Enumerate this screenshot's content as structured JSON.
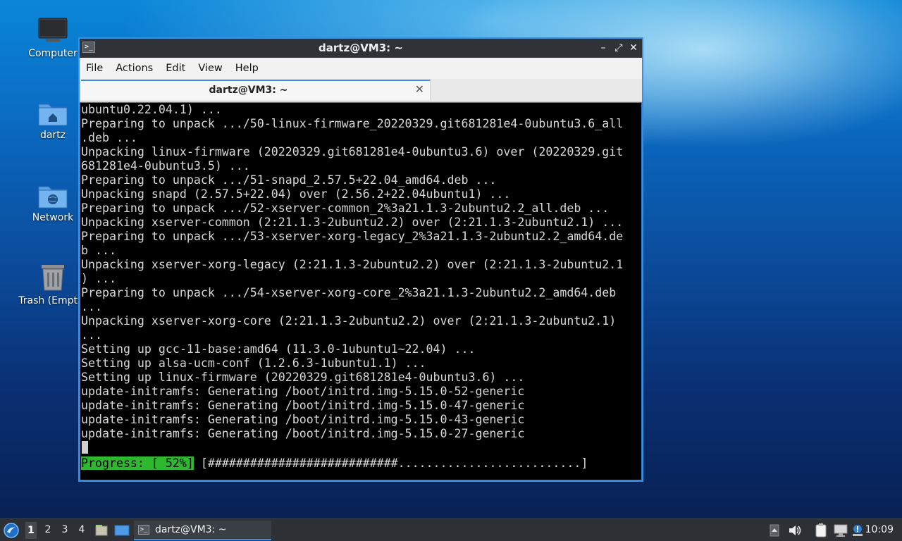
{
  "desktop": {
    "icons": [
      {
        "label": "Computer"
      },
      {
        "label": "dartz"
      },
      {
        "label": "Network"
      },
      {
        "label": "Trash (Empty)"
      }
    ]
  },
  "window": {
    "title": "dartz@VM3: ~",
    "menu": [
      "File",
      "Actions",
      "Edit",
      "View",
      "Help"
    ],
    "tab_label": "dartz@VM3: ~",
    "controls": {
      "minimize": "–",
      "maximize": "⤢",
      "close": "✕",
      "tab_close": "✕"
    }
  },
  "terminal": {
    "lines": [
      "ubuntu0.22.04.1) ...",
      "Preparing to unpack .../50-linux-firmware_20220329.git681281e4-0ubuntu3.6_all",
      ".deb ...",
      "Unpacking linux-firmware (20220329.git681281e4-0ubuntu3.6) over (20220329.git",
      "681281e4-0ubuntu3.5) ...",
      "Preparing to unpack .../51-snapd_2.57.5+22.04_amd64.deb ...",
      "Unpacking snapd (2.57.5+22.04) over (2.56.2+22.04ubuntu1) ...",
      "Preparing to unpack .../52-xserver-common_2%3a21.1.3-2ubuntu2.2_all.deb ...",
      "Unpacking xserver-common (2:21.1.3-2ubuntu2.2) over (2:21.1.3-2ubuntu2.1) ...",
      "Preparing to unpack .../53-xserver-xorg-legacy_2%3a21.1.3-2ubuntu2.2_amd64.de",
      "b ...",
      "Unpacking xserver-xorg-legacy (2:21.1.3-2ubuntu2.2) over (2:21.1.3-2ubuntu2.1",
      ") ...",
      "Preparing to unpack .../54-xserver-xorg-core_2%3a21.1.3-2ubuntu2.2_amd64.deb",
      "...",
      "Unpacking xserver-xorg-core (2:21.1.3-2ubuntu2.2) over (2:21.1.3-2ubuntu2.1)",
      "...",
      "Setting up gcc-11-base:amd64 (11.3.0-1ubuntu1~22.04) ...",
      "Setting up alsa-ucm-conf (1.2.6.3-1ubuntu1.1) ...",
      "Setting up linux-firmware (20220329.git681281e4-0ubuntu3.6) ...",
      "update-initramfs: Generating /boot/initrd.img-5.15.0-52-generic",
      "update-initramfs: Generating /boot/initrd.img-5.15.0-47-generic",
      "update-initramfs: Generating /boot/initrd.img-5.15.0-43-generic",
      "update-initramfs: Generating /boot/initrd.img-5.15.0-27-generic"
    ],
    "progress_label": "Progress: [ 52%]",
    "progress_bar": "[###########################..........................]",
    "progress_percent": 52
  },
  "taskbar": {
    "workspaces": [
      "1",
      "2",
      "3",
      "4"
    ],
    "active_workspace": "1",
    "task_label": "dartz@VM3: ~",
    "clock": "10:09",
    "tray_icons": [
      "arrow-up-icon",
      "volume-icon",
      "clipboard-icon",
      "network-icon",
      "update-notifier-icon"
    ]
  },
  "colors": {
    "accent": "#3b8ee0",
    "progress_green": "#2eb82e",
    "terminal_bg": "#000000"
  }
}
